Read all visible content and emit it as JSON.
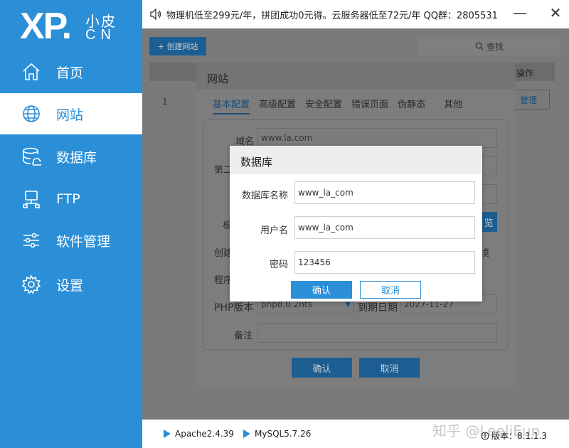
{
  "logo": {
    "main": "XP.",
    "cn_top": "小皮",
    "cn_bottom": "CN"
  },
  "sidebar": {
    "items": [
      {
        "label": "首页",
        "icon": "home-icon",
        "active": false
      },
      {
        "label": "网站",
        "icon": "globe-icon",
        "active": true
      },
      {
        "label": "数据库",
        "icon": "database-icon",
        "active": false
      },
      {
        "label": "FTP",
        "icon": "ftp-icon",
        "active": false
      },
      {
        "label": "软件管理",
        "icon": "sliders-icon",
        "active": false
      },
      {
        "label": "设置",
        "icon": "gear-icon",
        "active": false
      }
    ]
  },
  "topbar": {
    "notice": "物理机低至299元/年，拼团成功0元得。云服务器低至72元/年  QQ群：2805531",
    "minimize": "—",
    "close": "✕"
  },
  "toolbar": {
    "create_label": "+ 创建网站",
    "search_label": "查找"
  },
  "table": {
    "op_header": "操作",
    "row_num": "1",
    "manage_label": "管理"
  },
  "site_dialog": {
    "title": "网站",
    "tabs": [
      "基本配置",
      "高级配置",
      "安全配置",
      "错误页面",
      "伪静态",
      "其他"
    ],
    "labels": {
      "domain": "域名",
      "second": "第二",
      "root": "根",
      "create": "创建",
      "program": "程序",
      "php": "PHP版本",
      "expire": "到期日期",
      "note": "备注",
      "env": "境"
    },
    "values": {
      "domain": "www.la.com",
      "php": "php8.0.2nts",
      "expire": "2027-11-27",
      "browse": "览"
    },
    "confirm": "确认",
    "cancel": "取消"
  },
  "db_dialog": {
    "title": "数据库",
    "name_label": "数据库名称",
    "name_value": "www_la_com",
    "user_label": "用户名",
    "user_value": "www_la_com",
    "pass_label": "密码",
    "pass_value": "123456",
    "confirm": "确认",
    "cancel": "取消"
  },
  "status": {
    "apache": "Apache2.4.39",
    "mysql": "MySQL5.7.26",
    "watermark": "知乎 @LeeJiEun",
    "version": "版本：8.1.1.3"
  },
  "colors": {
    "accent": "#2b8fd8",
    "dim_overlay": "#7a7a7a"
  }
}
